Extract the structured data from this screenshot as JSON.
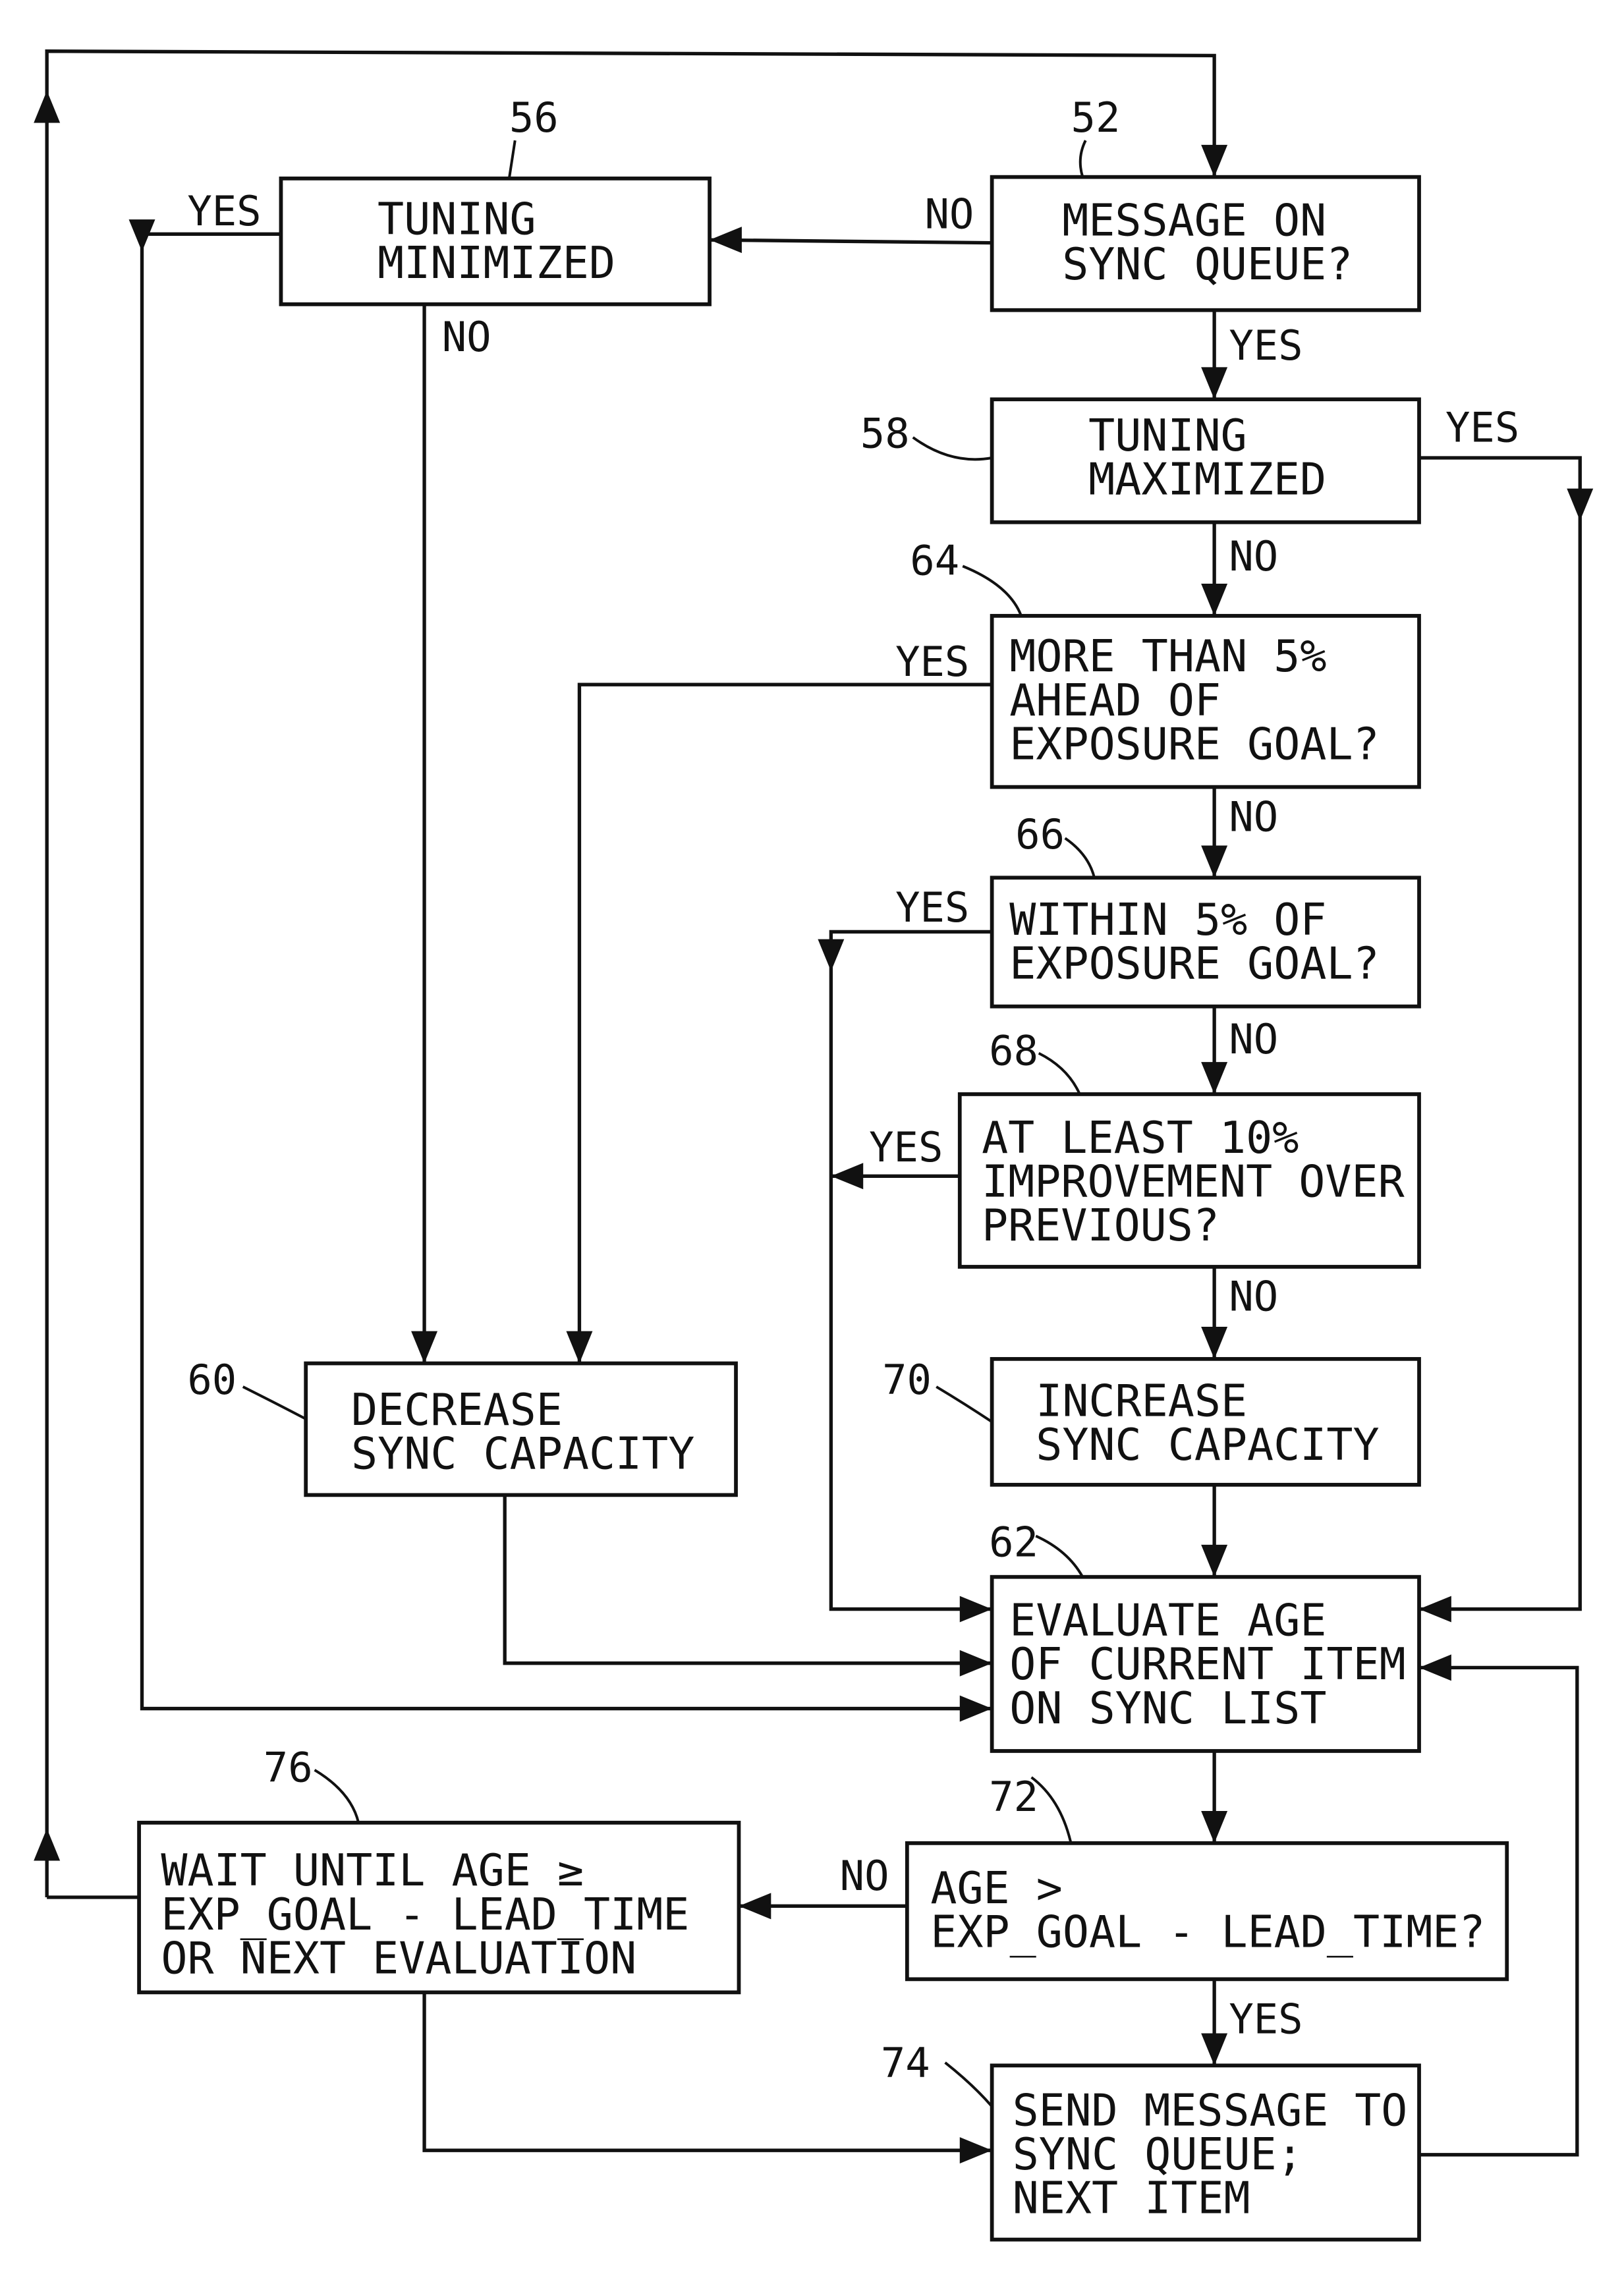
{
  "figure": {
    "nodes": [
      {
        "id": "52",
        "ref": "52",
        "lines": [
          "MESSAGE ON",
          "SYNC QUEUE?"
        ]
      },
      {
        "id": "56",
        "ref": "56",
        "lines": [
          "TUNING",
          "MINIMIZED"
        ]
      },
      {
        "id": "58",
        "ref": "58",
        "lines": [
          "TUNING",
          "MAXIMIZED"
        ]
      },
      {
        "id": "64",
        "ref": "64",
        "lines": [
          "MORE THAN 5%",
          "AHEAD OF",
          "EXPOSURE GOAL?"
        ]
      },
      {
        "id": "66",
        "ref": "66",
        "lines": [
          "WITHIN 5% OF",
          "EXPOSURE GOAL?"
        ]
      },
      {
        "id": "68",
        "ref": "68",
        "lines": [
          "AT LEAST 10%",
          "IMPROVEMENT OVER",
          "PREVIOUS?"
        ]
      },
      {
        "id": "60",
        "ref": "60",
        "lines": [
          "DECREASE",
          "SYNC CAPACITY"
        ]
      },
      {
        "id": "70",
        "ref": "70",
        "lines": [
          "INCREASE",
          "SYNC CAPACITY"
        ]
      },
      {
        "id": "62",
        "ref": "62",
        "lines": [
          "EVALUATE AGE",
          "OF CURRENT ITEM",
          "ON SYNC LIST"
        ]
      },
      {
        "id": "72",
        "ref": "72",
        "lines": [
          "AGE >",
          "EXP_GOAL - LEAD_TIME?"
        ]
      },
      {
        "id": "76",
        "ref": "76",
        "lines": [
          "WAIT UNTIL AGE ≥",
          "EXP_GOAL - LEAD_TIME",
          "OR NEXT EVALUATION"
        ]
      },
      {
        "id": "74",
        "ref": "74",
        "lines": [
          "SEND MESSAGE TO",
          "SYNC QUEUE;",
          "NEXT ITEM"
        ]
      }
    ],
    "edge_labels": [
      {
        "id": "52-no",
        "text": "NO"
      },
      {
        "id": "52-yes",
        "text": "YES"
      },
      {
        "id": "56-yes",
        "text": "YES"
      },
      {
        "id": "56-no",
        "text": "NO"
      },
      {
        "id": "58-yes",
        "text": "YES"
      },
      {
        "id": "58-no",
        "text": "NO"
      },
      {
        "id": "64-yes",
        "text": "YES"
      },
      {
        "id": "64-no",
        "text": "NO"
      },
      {
        "id": "66-yes",
        "text": "YES"
      },
      {
        "id": "66-no",
        "text": "NO"
      },
      {
        "id": "68-yes",
        "text": "YES"
      },
      {
        "id": "68-no",
        "text": "NO"
      },
      {
        "id": "72-no",
        "text": "NO"
      },
      {
        "id": "72-yes",
        "text": "YES"
      }
    ],
    "edges": [
      {
        "from": "76",
        "to": "52",
        "label": ""
      },
      {
        "from": "52",
        "to": "56",
        "label": "NO"
      },
      {
        "from": "52",
        "to": "58",
        "label": "YES"
      },
      {
        "from": "56",
        "to": "62",
        "label": "YES"
      },
      {
        "from": "56",
        "to": "60",
        "label": "NO"
      },
      {
        "from": "58",
        "to": "62",
        "label": "YES"
      },
      {
        "from": "58",
        "to": "64",
        "label": "NO"
      },
      {
        "from": "64",
        "to": "60",
        "label": "YES"
      },
      {
        "from": "64",
        "to": "66",
        "label": "NO"
      },
      {
        "from": "66",
        "to": "62",
        "label": "YES"
      },
      {
        "from": "66",
        "to": "68",
        "label": "NO"
      },
      {
        "from": "68",
        "to": "62",
        "label": "YES"
      },
      {
        "from": "68",
        "to": "70",
        "label": "NO"
      },
      {
        "from": "60",
        "to": "62",
        "label": ""
      },
      {
        "from": "70",
        "to": "62",
        "label": ""
      },
      {
        "from": "62",
        "to": "72",
        "label": ""
      },
      {
        "from": "72",
        "to": "76",
        "label": "NO"
      },
      {
        "from": "72",
        "to": "74",
        "label": "YES"
      },
      {
        "from": "76",
        "to": "74",
        "label": ""
      },
      {
        "from": "74",
        "to": "62",
        "label": ""
      }
    ]
  }
}
